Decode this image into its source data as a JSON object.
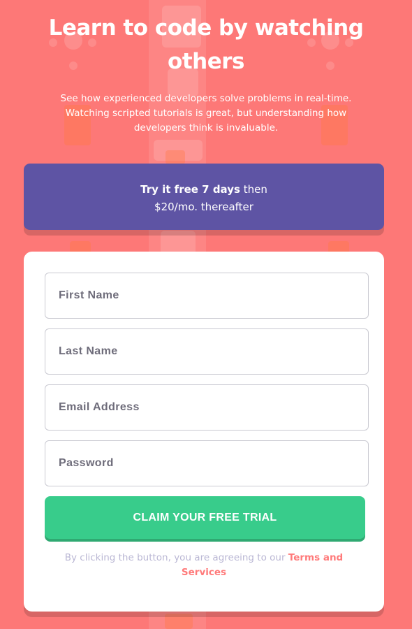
{
  "hero": {
    "headline": "Learn to code by watching others",
    "intro": "See how experienced developers solve problems in real-time. Watching scripted tutorials is great, but understanding how developers think is invaluable."
  },
  "promo": {
    "bold_text": "Try it free 7 days",
    "text_after_bold": " then",
    "price_text": "$20/mo. thereafter"
  },
  "form": {
    "first_name_placeholder": "First Name",
    "last_name_placeholder": "Last Name",
    "email_placeholder": "Email Address",
    "password_placeholder": "Password",
    "submit_label": "CLAIM YOUR FREE TRIAL",
    "terms_prefix": "By clicking the button, you are agreeing to our ",
    "terms_link": "Terms and Services"
  },
  "colors": {
    "background": "#fd7877",
    "promo_bg": "#5e54a4",
    "cta_bg": "#38cc8b",
    "link": "#ff7a7a"
  }
}
